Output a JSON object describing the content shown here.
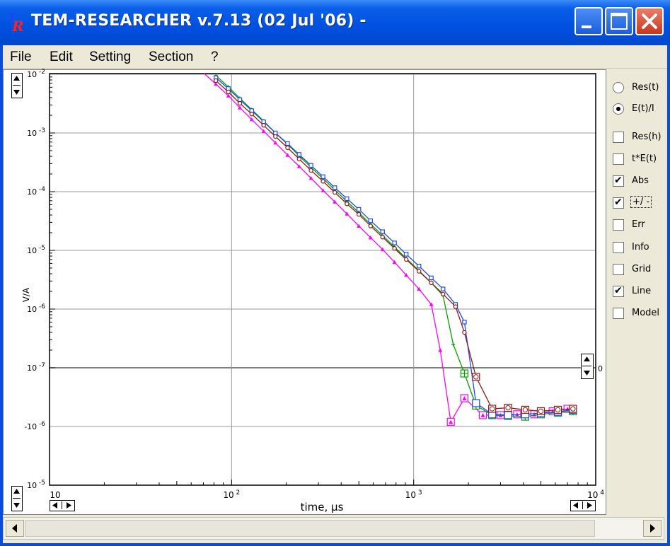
{
  "window": {
    "title": "TEM-RESEARCHER v.7.13 (02 Jul '06) -",
    "logo_text_top": "T",
    "logo_text_bottom": "R"
  },
  "menu": [
    "File",
    "Edit",
    "Setting",
    "Section",
    "?"
  ],
  "side_options": [
    {
      "type": "radio",
      "label": "Res(t)",
      "checked": false
    },
    {
      "type": "radio",
      "label": "E(t)/I",
      "checked": true
    },
    {
      "type": "checkbox",
      "label": "Res(h)",
      "checked": false
    },
    {
      "type": "checkbox",
      "label": "t*E(t)",
      "checked": false
    },
    {
      "type": "checkbox",
      "label": "Abs",
      "checked": true
    },
    {
      "type": "checkbox",
      "label": "+/ -",
      "checked": true
    },
    {
      "type": "checkbox",
      "label": "Err",
      "checked": false
    },
    {
      "type": "checkbox",
      "label": "Info",
      "checked": false
    },
    {
      "type": "checkbox",
      "label": "Grid",
      "checked": false
    },
    {
      "type": "checkbox",
      "label": "Line",
      "checked": true
    },
    {
      "type": "checkbox",
      "label": "Model",
      "checked": false
    }
  ],
  "zero_marker": "0",
  "chart_data": {
    "type": "line",
    "xlabel": "time, µs",
    "ylabel": "V/A",
    "x_scale": "log",
    "xlim": [
      10,
      10000
    ],
    "x_ticks": [
      {
        "base": "10",
        "exp": ""
      },
      {
        "base": "10",
        "exp": "2"
      },
      {
        "base": "10",
        "exp": "3"
      },
      {
        "base": "10",
        "exp": "4"
      }
    ],
    "y_ticks": [
      {
        "base": "10",
        "exp": "-2"
      },
      {
        "base": "10",
        "exp": "-3"
      },
      {
        "base": "10",
        "exp": "-4"
      },
      {
        "base": "10",
        "exp": "-5"
      },
      {
        "base": "10",
        "exp": "-6"
      },
      {
        "base": "10",
        "exp": "-7"
      },
      {
        "base": "-10",
        "exp": "-6"
      },
      {
        "base": "10",
        "exp": "-5"
      }
    ],
    "y_note": "symmetric signed log scale: 1e-2 at top down to 1e-7, 0 line, then negative values to -1e-5",
    "series": [
      {
        "color": "#FF00FF",
        "marker": "triangle",
        "points": [
          [
            65,
            0.013
          ],
          [
            82,
            0.0068
          ],
          [
            96,
            0.0043
          ],
          [
            111,
            0.0027
          ],
          [
            129,
            0.0017
          ],
          [
            150,
            0.00107
          ],
          [
            174,
            0.00068
          ],
          [
            203,
            0.00042
          ],
          [
            235,
            0.00027
          ],
          [
            273,
            0.00017
          ],
          [
            318,
            0.000105
          ],
          [
            369,
            6.7e-05
          ],
          [
            430,
            4.2e-05
          ],
          [
            500,
            2.6e-05
          ],
          [
            580,
            1.65e-05
          ],
          [
            675,
            1.04e-05
          ],
          [
            785,
            6.3e-06
          ],
          [
            910,
            3.8e-06
          ],
          [
            1070,
            2.2e-06
          ],
          [
            1250,
            1.2e-06
          ],
          [
            1400,
            2e-07
          ],
          [
            1600,
            1.2e-08
          ],
          [
            1900,
            -3.3e-07
          ],
          [
            2400,
            -6.4e-07
          ],
          [
            3000,
            -6.4e-07
          ],
          [
            3700,
            -6.2e-07
          ],
          [
            4600,
            -6.2e-07
          ],
          [
            5800,
            -5.5e-07
          ],
          [
            7000,
            -5e-07
          ]
        ]
      },
      {
        "color": "#00A000",
        "marker": "cross",
        "points": [
          [
            82,
            0.0095
          ],
          [
            96,
            0.0061
          ],
          [
            111,
            0.0039
          ],
          [
            129,
            0.0025
          ],
          [
            150,
            0.0016
          ],
          [
            174,
            0.001
          ],
          [
            203,
            0.00064
          ],
          [
            235,
            0.00041
          ],
          [
            273,
            0.00026
          ],
          [
            318,
            0.000167
          ],
          [
            369,
            0.000107
          ],
          [
            430,
            6.8e-05
          ],
          [
            500,
            4.4e-05
          ],
          [
            580,
            2.8e-05
          ],
          [
            675,
            1.8e-05
          ],
          [
            785,
            1.14e-05
          ],
          [
            910,
            7.3e-06
          ],
          [
            1070,
            4.5e-06
          ],
          [
            1250,
            2.8e-06
          ],
          [
            1450,
            1.7e-06
          ],
          [
            1650,
            2.5e-07
          ],
          [
            1900,
            8e-08
          ],
          [
            2200,
            -4.4e-07
          ],
          [
            2700,
            -6.4e-07
          ],
          [
            3300,
            -6.6e-07
          ],
          [
            4100,
            -6.8e-07
          ],
          [
            5000,
            -6.2e-07
          ],
          [
            6200,
            -5.8e-07
          ],
          [
            7500,
            -5.5e-07
          ]
        ]
      },
      {
        "color": "#1E4CE8",
        "marker": "square",
        "points": [
          [
            82,
            0.0087
          ],
          [
            96,
            0.0057
          ],
          [
            111,
            0.0037
          ],
          [
            129,
            0.0024
          ],
          [
            150,
            0.00155
          ],
          [
            174,
            0.001
          ],
          [
            203,
            0.00066
          ],
          [
            235,
            0.00043
          ],
          [
            273,
            0.00028
          ],
          [
            318,
            0.00018
          ],
          [
            369,
            0.000117
          ],
          [
            430,
            7.6e-05
          ],
          [
            500,
            5e-05
          ],
          [
            580,
            3.2e-05
          ],
          [
            675,
            2.08e-05
          ],
          [
            785,
            1.34e-05
          ],
          [
            910,
            8.6e-06
          ],
          [
            1070,
            5.4e-06
          ],
          [
            1250,
            3.4e-06
          ],
          [
            1450,
            2.2e-06
          ],
          [
            1700,
            1.2e-06
          ],
          [
            1900,
            6e-07
          ],
          [
            2200,
            -4e-07
          ],
          [
            2700,
            -6.2e-07
          ],
          [
            3300,
            -6.4e-07
          ],
          [
            4100,
            -6.2e-07
          ],
          [
            5000,
            -5.9e-07
          ],
          [
            6200,
            -5.6e-07
          ],
          [
            7500,
            -5.2e-07
          ]
        ]
      },
      {
        "color": "#8B1A1A",
        "marker": "circle",
        "points": [
          [
            82,
            0.0078
          ],
          [
            96,
            0.005
          ],
          [
            111,
            0.0032
          ],
          [
            129,
            0.0021
          ],
          [
            150,
            0.00135
          ],
          [
            174,
            0.00087
          ],
          [
            203,
            0.00056
          ],
          [
            235,
            0.00036
          ],
          [
            273,
            0.00023
          ],
          [
            318,
            0.00015
          ],
          [
            369,
            9.7e-05
          ],
          [
            430,
            6.2e-05
          ],
          [
            500,
            4.1e-05
          ],
          [
            580,
            2.6e-05
          ],
          [
            675,
            1.68e-05
          ],
          [
            785,
            1.08e-05
          ],
          [
            910,
            7e-06
          ],
          [
            1070,
            4.4e-06
          ],
          [
            1250,
            2.8e-06
          ],
          [
            1450,
            1.8e-06
          ],
          [
            1700,
            1.1e-06
          ],
          [
            1900,
            4e-07
          ],
          [
            2200,
            7e-08
          ],
          [
            2700,
            -5e-07
          ],
          [
            3300,
            -4.8e-07
          ],
          [
            4100,
            -5.2e-07
          ],
          [
            5000,
            -5.5e-07
          ],
          [
            6200,
            -5.2e-07
          ],
          [
            7500,
            -5e-07
          ]
        ]
      }
    ]
  }
}
